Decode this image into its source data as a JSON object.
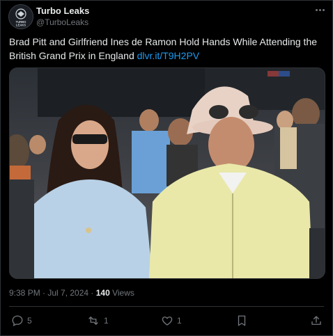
{
  "post": {
    "author_name": "Turbo Leaks",
    "author_handle": "@TurboLeaks",
    "avatar_text": "TURBO LEAKS",
    "text": "Brad Pitt and Girlfriend Ines de Ramon Hold Hands While Attending the British Grand Prix in England ",
    "link_text": "dlvr.it/T9H2PV",
    "timestamp": "9:38 PM · Jul 7, 2024 · ",
    "views_count": "140",
    "views_label": " Views",
    "media_alt": "Brad Pitt and Ines de Ramon walking together at the British Grand Prix"
  },
  "actions": {
    "replies": "5",
    "reposts": "1",
    "likes": "1"
  },
  "colors": {
    "background": "#000000",
    "text": "#e7e9ea",
    "secondary": "#71767b",
    "link": "#1d9bf0",
    "border": "#2f3336"
  },
  "icons": [
    "more-icon",
    "reply-icon",
    "repost-icon",
    "like-icon",
    "bookmark-icon",
    "share-icon"
  ]
}
